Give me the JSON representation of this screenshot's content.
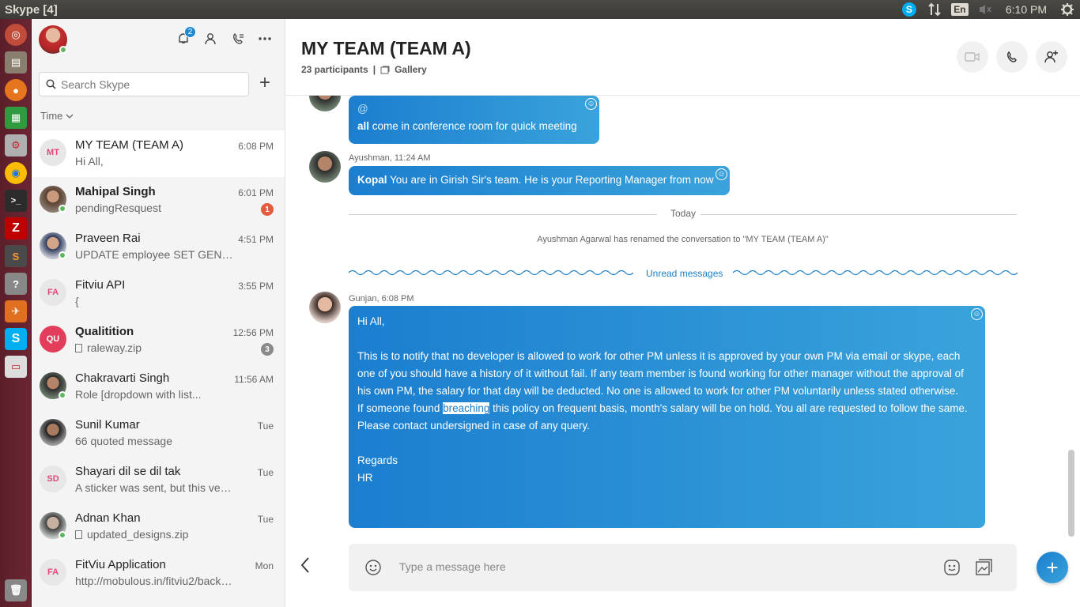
{
  "os": {
    "window_title": "Skype [4]",
    "tray_skype": "S",
    "keyboard": "En",
    "clock": "6:10 PM"
  },
  "launcher": {
    "items": [
      "ubuntu-dash",
      "files",
      "firefox",
      "libreoffice-calc",
      "system-settings",
      "chrome",
      "terminal",
      "filezilla",
      "sublime-text",
      "help",
      "postman",
      "skype",
      "document-viewer",
      "trash"
    ]
  },
  "sidebar": {
    "notifications_count": "2",
    "search_placeholder": "Search Skype",
    "sort_label": "Time",
    "conversations": [
      {
        "name": "MY TEAM (TEAM A)",
        "initials": "MT",
        "preview": "Hi All,",
        "time": "6:08 PM",
        "badge": "",
        "bold": false
      },
      {
        "name": "Mahipal Singh",
        "initials": "",
        "preview": "pendingResquest",
        "time": "6:01 PM",
        "badge": "1",
        "bold": true
      },
      {
        "name": "Praveen Rai",
        "initials": "",
        "preview": "UPDATE employee SET GEND...",
        "time": "4:51 PM",
        "badge": "",
        "bold": false
      },
      {
        "name": "Fitviu API",
        "initials": "FA",
        "preview": "{",
        "time": "3:55 PM",
        "badge": "",
        "bold": false
      },
      {
        "name": "Qualitition",
        "initials": "QU",
        "preview": "raleway.zip",
        "time": "12:56 PM",
        "badge": "3",
        "bold": true
      },
      {
        "name": "Chakravarti Singh",
        "initials": "",
        "preview": "Role [dropdown      with list...",
        "time": "11:56 AM",
        "badge": "",
        "bold": false
      },
      {
        "name": "Sunil Kumar",
        "initials": "",
        "preview": "66 quoted message",
        "time": "Tue",
        "badge": "",
        "bold": false
      },
      {
        "name": "Shayari dil se dil tak",
        "initials": "SD",
        "preview": "A sticker was sent, but this versio...",
        "time": "Tue",
        "badge": "",
        "bold": false
      },
      {
        "name": "Adnan Khan",
        "initials": "",
        "preview": "updated_designs.zip",
        "time": "Tue",
        "badge": "",
        "bold": false
      },
      {
        "name": "FitViu Application",
        "initials": "FA",
        "preview": "http://mobulous.in/fitviu2/backe...",
        "time": "Mon",
        "badge": "",
        "bold": false
      }
    ]
  },
  "chat": {
    "title": "MY TEAM (TEAM A)",
    "participants": "23 participants",
    "separator": "|",
    "gallery": "Gallery",
    "messages": [
      {
        "mention_symbol": "@",
        "mention": "all",
        "text": " come in conference room for quick meeting"
      },
      {
        "sender": "Ayushman, 11:24 AM",
        "mention": "Kopal",
        "text": " You are in Girish Sir's team. He is your Reporting Manager from now"
      }
    ],
    "day_divider": "Today",
    "system_message": "Ayushman Agarwal has renamed the conversation to \"MY TEAM (TEAM A)\"",
    "unread_label": "Unread messages",
    "hr_message": {
      "sender": "Gunjan, 6:08 PM",
      "greeting": "Hi All,",
      "para1": "This is to notify that no developer is allowed to work for other PM unless it is approved by your own PM via email or skype, each one of you should have a history of it without fail. If any team member is found working for other manager without the approval of his own PM, the salary for that day will be deducted. No one is allowed to work for other PM voluntarily unless stated otherwise.",
      "para2_before": "If someone found ",
      "para2_highlight": "breaching",
      "para2_after": " this policy on frequent basis, month's salary will be on hold. You all are requested to follow the same.",
      "para3": "Please contact undersigned in case of any query.",
      "regards": "Regards",
      "signature": "HR"
    },
    "composer_placeholder": "Type a message here",
    "send_label": "+"
  },
  "colors": {
    "bubble_start": "#1b7ecf",
    "bubble_end": "#3aa3db",
    "launcher": "#6d2533",
    "badge_red": "#e25c3d"
  }
}
